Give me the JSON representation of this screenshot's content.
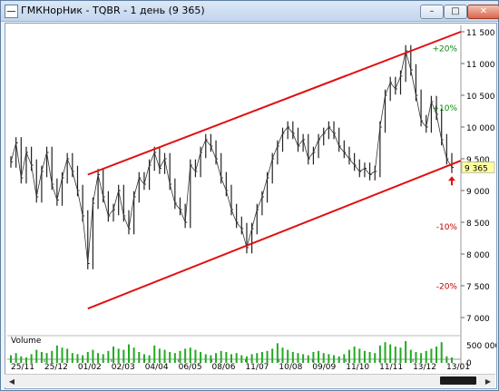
{
  "window": {
    "title": "ГМКНорНик - TQBR - 1 день (9 365)",
    "buttons": {
      "minimize": "–",
      "maximize": "□",
      "close": "✕"
    }
  },
  "chart_data": {
    "type": "line",
    "title": "",
    "ylim": [
      6800,
      11600
    ],
    "y_ticks": [
      {
        "label": "11 500",
        "value": 11500
      },
      {
        "label": "11 000",
        "value": 11000
      },
      {
        "label": "10 500",
        "value": 10500
      },
      {
        "label": "10 000",
        "value": 10000
      },
      {
        "label": "9 500",
        "value": 9500
      },
      {
        "label": "9 000",
        "value": 9000
      },
      {
        "label": "8 500",
        "value": 8500
      },
      {
        "label": "8 000",
        "value": 8000
      },
      {
        "label": "7 500",
        "value": 7500
      },
      {
        "label": "7 000",
        "value": 7000
      }
    ],
    "x_ticks": [
      "25/11",
      "25/12",
      "01/02",
      "02/03",
      "04/04",
      "06/05",
      "08/06",
      "11/07",
      "10/08",
      "09/09",
      "11/10",
      "11/11",
      "13/12",
      "13/01"
    ],
    "last_price_label": "9 365",
    "last_price": 9365,
    "percent_levels": [
      {
        "label": "+20%",
        "value": 11238,
        "color": "#0a8a0a"
      },
      {
        "label": "+10%",
        "value": 10302,
        "color": "#0a8a0a"
      },
      {
        "label": "-10%",
        "value": 8428,
        "color": "#c00000"
      },
      {
        "label": "-20%",
        "value": 7492,
        "color": "#c00000"
      }
    ],
    "series": [
      {
        "values": [
          9450,
          9750,
          9200,
          9600,
          9400,
          8900,
          9300,
          9600,
          9100,
          8850,
          9200,
          9500,
          9300,
          9000,
          8600,
          7850,
          8800,
          9250,
          8900,
          8600,
          8700,
          9000,
          8600,
          8400,
          8900,
          9200,
          9100,
          9400,
          9600,
          9350,
          9500,
          9100,
          8800,
          8700,
          8500,
          9400,
          9300,
          9600,
          9800,
          9700,
          9500,
          9200,
          9000,
          8700,
          8500,
          8400,
          8100,
          8400,
          8700,
          8900,
          9200,
          9500,
          9700,
          9900,
          10000,
          9900,
          9700,
          9800,
          9500,
          9600,
          9800,
          9900,
          10000,
          9900,
          9700,
          9600,
          9500,
          9400,
          9300,
          9350,
          9250,
          9300,
          10000,
          10500,
          10700,
          10600,
          10800,
          11200,
          10900,
          10500,
          10100,
          10000,
          10400,
          10200,
          9800,
          9500,
          9365
        ]
      },
      {
        "name": "Volume",
        "values": [
          70,
          90,
          60,
          50,
          80,
          120,
          100,
          90,
          110,
          160,
          140,
          130,
          90,
          80,
          70,
          100,
          120,
          90,
          80,
          110,
          150,
          130,
          120,
          170,
          140,
          100,
          80,
          70,
          160,
          130,
          120,
          100,
          90,
          110,
          130,
          140,
          120,
          100,
          80,
          70,
          90,
          110,
          100,
          80,
          90,
          70,
          60,
          80,
          90,
          100,
          110,
          130,
          180,
          140,
          120,
          100,
          90,
          80,
          70,
          100,
          110,
          90,
          80,
          70,
          60,
          80,
          120,
          150,
          130,
          110,
          100,
          90,
          160,
          190,
          170,
          150,
          140,
          200,
          120,
          100,
          90,
          110,
          130,
          150,
          190,
          60,
          50
        ]
      }
    ],
    "channel_color": "#e01010",
    "volume_label": "Volume",
    "volume_tick_labels": [
      "500 000",
      "0"
    ]
  }
}
